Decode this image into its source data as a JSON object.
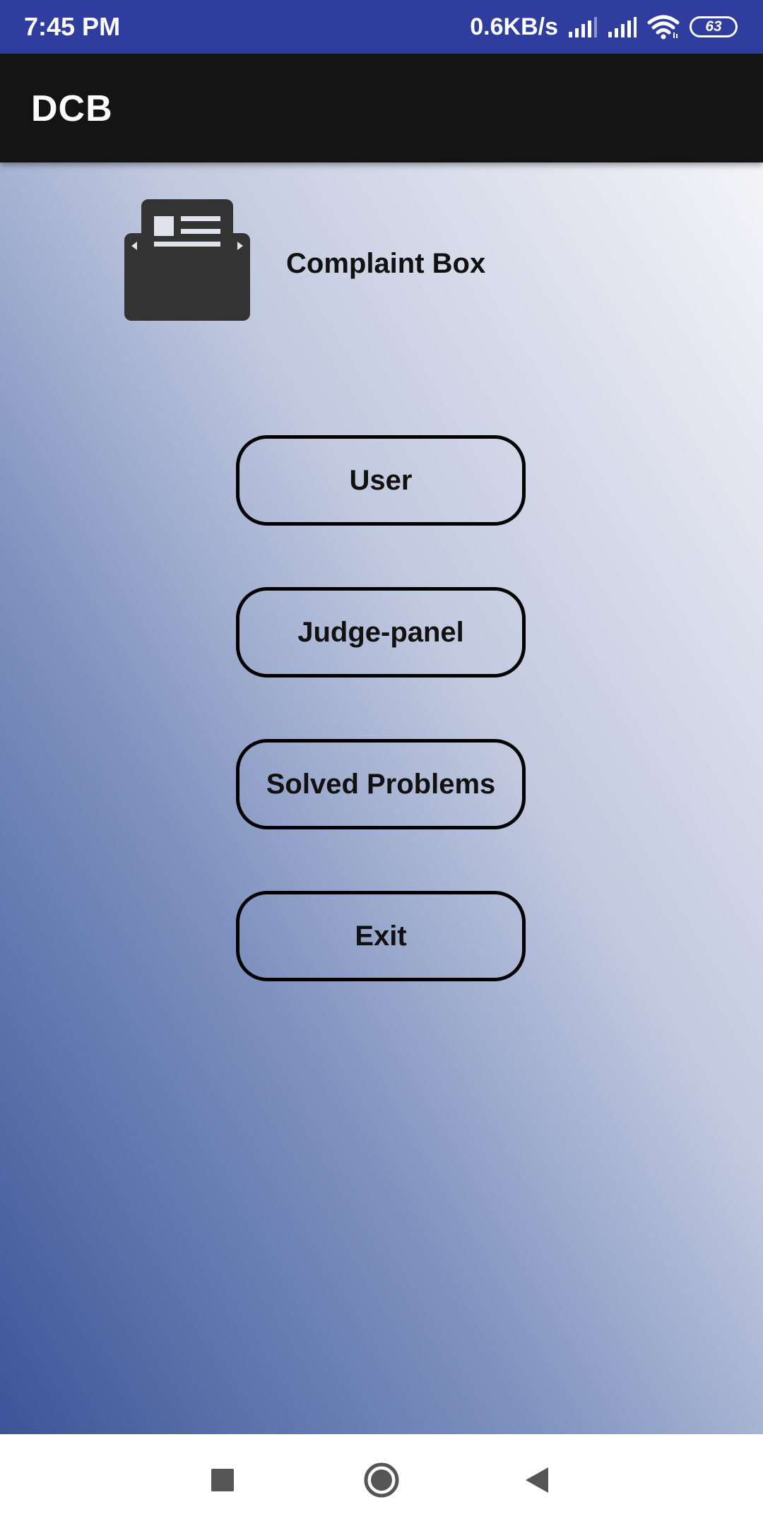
{
  "status_bar": {
    "time": "7:45 PM",
    "net_speed": "0.6KB/s",
    "battery_level": "63",
    "background": "#2f3d9f"
  },
  "app_bar": {
    "title": "DCB",
    "background": "#141414"
  },
  "header": {
    "icon": "newspaper-envelope-icon",
    "label": "Complaint Box"
  },
  "menu": {
    "buttons": [
      {
        "label": "User"
      },
      {
        "label": "Judge-panel"
      },
      {
        "label": "Solved Problems"
      },
      {
        "label": "Exit"
      }
    ]
  },
  "nav_bar": {
    "icons": [
      "recents-square-icon",
      "home-circle-icon",
      "back-triangle-icon"
    ]
  },
  "colors": {
    "gradient_bottom_left": "#3b5598",
    "gradient_top_right": "#f4f4f8",
    "icon_fill": "#333333"
  }
}
